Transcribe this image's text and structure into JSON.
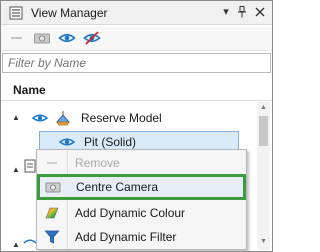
{
  "window": {
    "title": "View Manager",
    "dropdown_glyph": "▾",
    "pin_glyph": "📌",
    "close_glyph": "✕"
  },
  "toolbar": {
    "items": [
      {
        "name": "remove-icon",
        "enabled": false
      },
      {
        "name": "camera-icon",
        "enabled": false
      },
      {
        "name": "eye-icon",
        "enabled": true
      },
      {
        "name": "eye-hidden-icon",
        "enabled": true
      }
    ]
  },
  "filter": {
    "placeholder": "Filter by Name",
    "value": ""
  },
  "columns": {
    "name_header": "Name"
  },
  "tree": {
    "rows": [
      {
        "label": "Reserve Model",
        "expander": "▲",
        "visible": true
      },
      {
        "label": "Pit (Solid)",
        "visible": true,
        "selected": true
      }
    ],
    "partial_expanders": [
      "▲",
      "▲"
    ]
  },
  "context_menu": {
    "items": [
      {
        "label": "Remove",
        "icon": "remove-icon",
        "enabled": false
      },
      {
        "label": "Centre Camera",
        "icon": "camera-icon",
        "enabled": true,
        "highlighted": true
      },
      {
        "label": "Add Dynamic Colour",
        "icon": "colour-palette-icon",
        "enabled": true
      },
      {
        "label": "Add Dynamic Filter",
        "icon": "funnel-icon",
        "enabled": true
      }
    ]
  },
  "colors": {
    "accent_eye": "#1f78c8",
    "highlight_border": "#3a9b3f",
    "selection_bg": "#d9ebf9"
  }
}
